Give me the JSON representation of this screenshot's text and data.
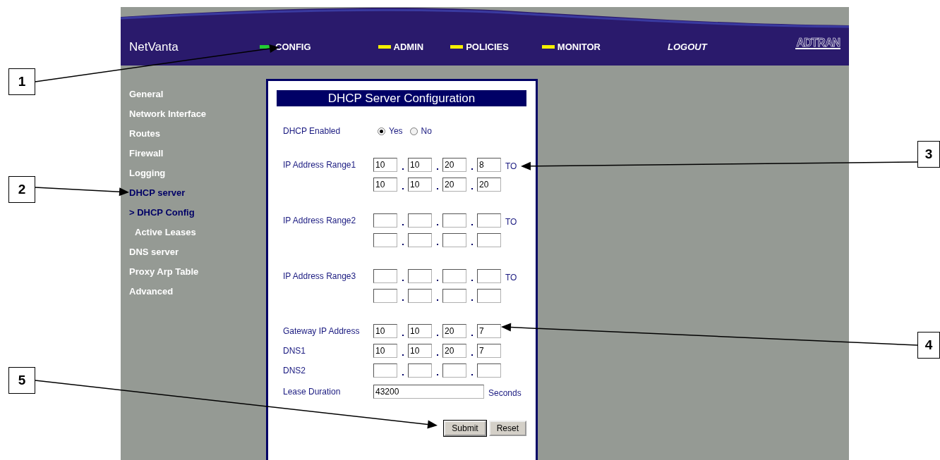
{
  "header": {
    "brand": "NetVanta",
    "nav": [
      {
        "label": "CONFIG",
        "selected": true
      },
      {
        "label": "ADMIN",
        "selected": false
      },
      {
        "label": "POLICIES",
        "selected": false
      },
      {
        "label": "MONITOR",
        "selected": false
      }
    ],
    "logout": "LOGOUT",
    "logo": "ADTRAN"
  },
  "sidebar": {
    "items": [
      {
        "label": "General",
        "selected": false
      },
      {
        "label": "Network Interface",
        "selected": false
      },
      {
        "label": "Routes",
        "selected": false
      },
      {
        "label": "Firewall",
        "selected": false
      },
      {
        "label": "Logging",
        "selected": false
      },
      {
        "label": "DHCP server",
        "selected": true,
        "children": [
          {
            "label": "> DHCP Config",
            "selected": true
          },
          {
            "label": "Active Leases",
            "selected": false
          }
        ]
      },
      {
        "label": "DNS server",
        "selected": false
      },
      {
        "label": "Proxy Arp Table",
        "selected": false
      },
      {
        "label": "Advanced",
        "selected": false
      }
    ]
  },
  "form": {
    "title": "DHCP Server Configuration",
    "dhcp_enabled": {
      "label": "DHCP Enabled",
      "options": [
        {
          "label": "Yes",
          "selected": true
        },
        {
          "label": "No",
          "selected": false
        }
      ]
    },
    "ranges": [
      {
        "label": "IP Address Range1",
        "to": "TO",
        "start": [
          {
            "value": "10"
          },
          {
            "value": "10"
          },
          {
            "value": "20"
          },
          {
            "value": "8"
          }
        ],
        "end": [
          {
            "value": "10"
          },
          {
            "value": "10"
          },
          {
            "value": "20"
          },
          {
            "value": "20"
          }
        ]
      },
      {
        "label": "IP Address Range2",
        "to": "TO"
      },
      {
        "label": "IP Address Range3",
        "to": "TO"
      }
    ],
    "addresses": [
      {
        "label": "Gateway IP Address",
        "octets": [
          {
            "value": "10"
          },
          {
            "value": "10"
          },
          {
            "value": "20"
          },
          {
            "value": "7"
          }
        ]
      },
      {
        "label": "DNS1",
        "octets": [
          {
            "value": "10"
          },
          {
            "value": "10"
          },
          {
            "value": "20"
          },
          {
            "value": "7"
          }
        ]
      },
      {
        "label": "DNS2"
      }
    ],
    "lease": {
      "label": "Lease Duration",
      "value": "43200",
      "unit": "Seconds"
    },
    "buttons": [
      {
        "label": "Submit"
      },
      {
        "label": "Reset"
      }
    ]
  },
  "callouts": [
    {
      "label": "1"
    },
    {
      "label": "2"
    },
    {
      "label": "3"
    },
    {
      "label": "4"
    },
    {
      "label": "5"
    }
  ]
}
